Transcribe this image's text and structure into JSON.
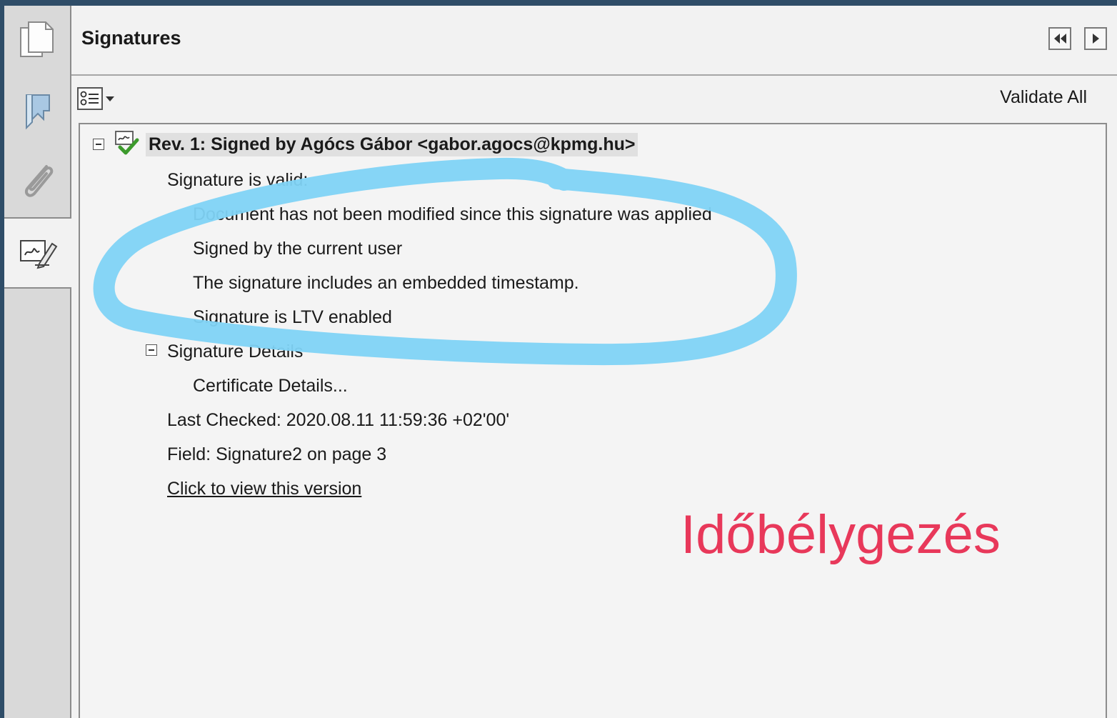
{
  "panel": {
    "title": "Signatures"
  },
  "toolbar": {
    "validate_all_label": "Validate All"
  },
  "signature": {
    "revision_title": "Rev. 1: Signed by Agócs Gábor <gabor.agocs@kpmg.hu>",
    "status_heading": "Signature is valid:",
    "status_lines": [
      "Document has not been modified since this signature was applied",
      "Signed by the current user",
      "The signature includes an embedded timestamp.",
      "Signature is LTV enabled"
    ],
    "details_heading": "Signature Details",
    "certificate_details_label": "Certificate Details...",
    "last_checked": "Last Checked: 2020.08.11 11:59:36 +02'00'",
    "field": "Field: Signature2 on page 3",
    "view_version_link": "Click to view this version"
  },
  "annotation": {
    "caption": "Időbélygezés",
    "circle_color": "#7fd3f5",
    "text_color": "#e8385a"
  },
  "nav_rail": {
    "items": [
      {
        "icon": "pages-icon"
      },
      {
        "icon": "bookmark-icon"
      },
      {
        "icon": "attachment-icon"
      },
      {
        "icon": "signature-panel-icon"
      }
    ]
  }
}
